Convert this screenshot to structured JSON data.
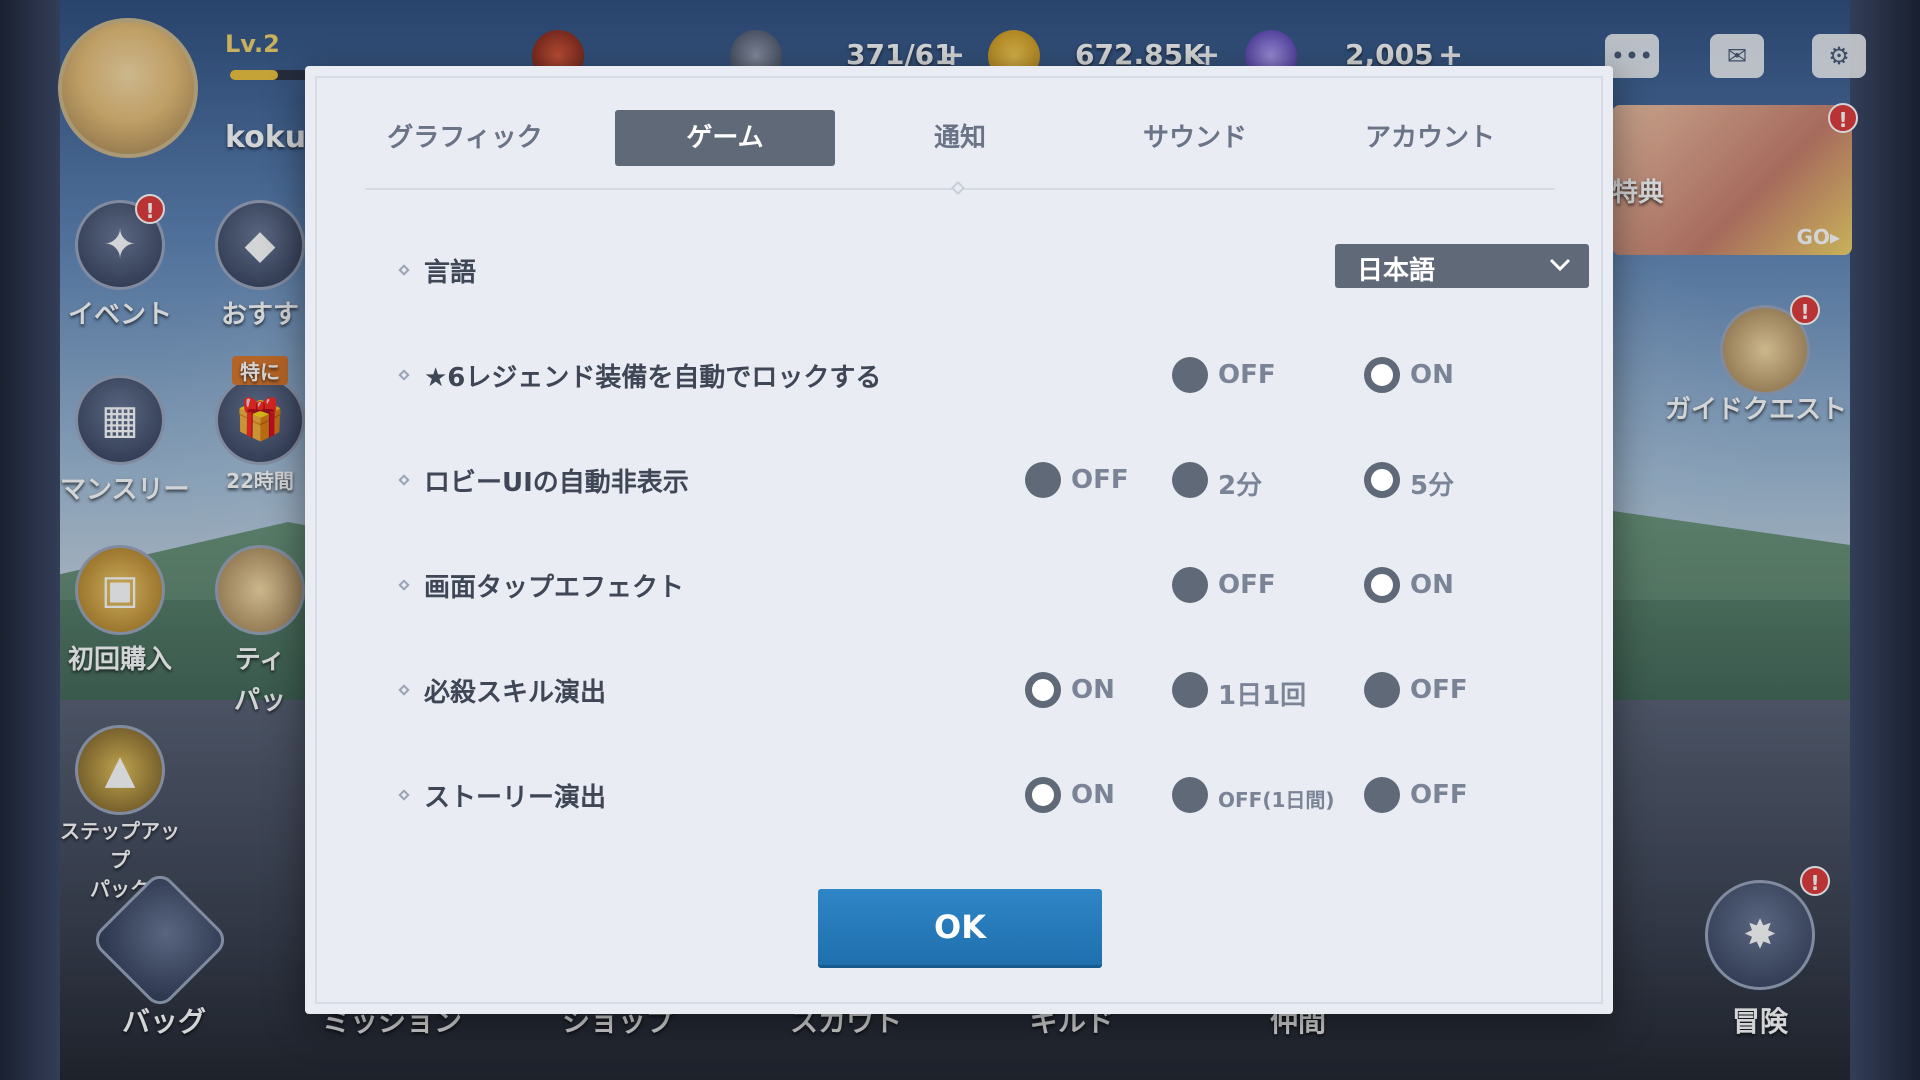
{
  "hud": {
    "level": "Lv.2",
    "level_progress": 0.6,
    "player_name": "kokut",
    "stamina": "371/61",
    "gold": "672.85K",
    "gems": "2,005",
    "plus": "+"
  },
  "left_menu": {
    "event": "イベント",
    "recommend": "おすす",
    "monthly": "マンスリー",
    "special_tag": "特に",
    "timer": "22時間",
    "first_purchase": "初回購入",
    "teto_1": "ティ",
    "teto_2": "パッ",
    "step_up_1": "ステップアップ",
    "step_up_2": "パック",
    "badge": "!"
  },
  "right_menu": {
    "promo_label": "特典",
    "promo_go": "GO▸",
    "guide_quest": "ガイドクエスト",
    "adventure": "冒険"
  },
  "bottom_nav": {
    "bag": "バッグ",
    "mission": "ミッション",
    "shop": "ショップ",
    "scout": "スカウト",
    "guild": "ギルド",
    "friends": "仲間"
  },
  "modal": {
    "tabs": [
      "グラフィック",
      "ゲーム",
      "通知",
      "サウンド",
      "アカウント"
    ],
    "active_tab": "ゲーム",
    "language": {
      "label": "言語",
      "value": "日本語"
    },
    "settings": [
      {
        "label": "★6レジェンド装備を自動でロックする",
        "options": [
          "OFF",
          "ON"
        ],
        "selected": "ON"
      },
      {
        "label": "ロビーUIの自動非表示",
        "options": [
          "OFF",
          "2分",
          "5分"
        ],
        "selected": "5分"
      },
      {
        "label": "画面タップエフェクト",
        "options": [
          "OFF",
          "ON"
        ],
        "selected": "ON"
      },
      {
        "label": "必殺スキル演出",
        "options": [
          "ON",
          "1日1回",
          "OFF"
        ],
        "selected": "ON"
      },
      {
        "label": "ストーリー演出",
        "options": [
          "ON",
          "OFF(1日間)",
          "OFF"
        ],
        "selected": "ON"
      }
    ],
    "ok_label": "OK"
  },
  "colors": {
    "accent": "#2f86c6",
    "tab_active": "#5f6977",
    "modal_bg": "#e9edf3"
  }
}
